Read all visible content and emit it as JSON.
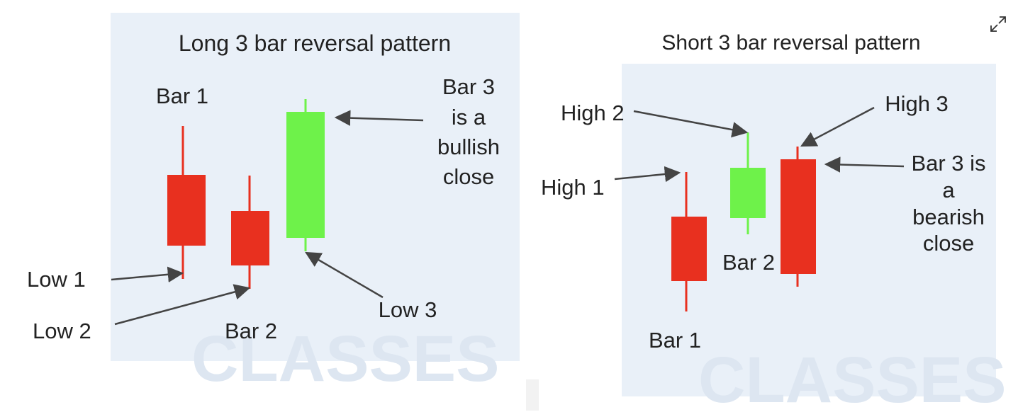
{
  "long_panel": {
    "title": "Long 3 bar reversal pattern",
    "bar1_label": "Bar 1",
    "bar2_label": "Bar 2",
    "low1_label": "Low 1",
    "low2_label": "Low 2",
    "low3_label": "Low 3",
    "bar3_note": [
      "Bar 3",
      "is a",
      "bullish",
      "close"
    ],
    "watermark": "CLASSES"
  },
  "short_panel": {
    "title": "Short 3 bar reversal pattern",
    "bar1_label": "Bar 1",
    "bar2_label": "Bar 2",
    "high1_label": "High 1",
    "high2_label": "High 2",
    "high3_label": "High 3",
    "bar3_note": [
      "Bar 3 is",
      "a",
      "bearish",
      "close"
    ],
    "watermark": "CLASSES"
  },
  "colors": {
    "panel_bg": "#e9f0f8",
    "bearish": "#e8301f",
    "bullish": "#6ef24a",
    "arrow": "#444444"
  },
  "icons": {
    "expand": "expand-icon"
  }
}
